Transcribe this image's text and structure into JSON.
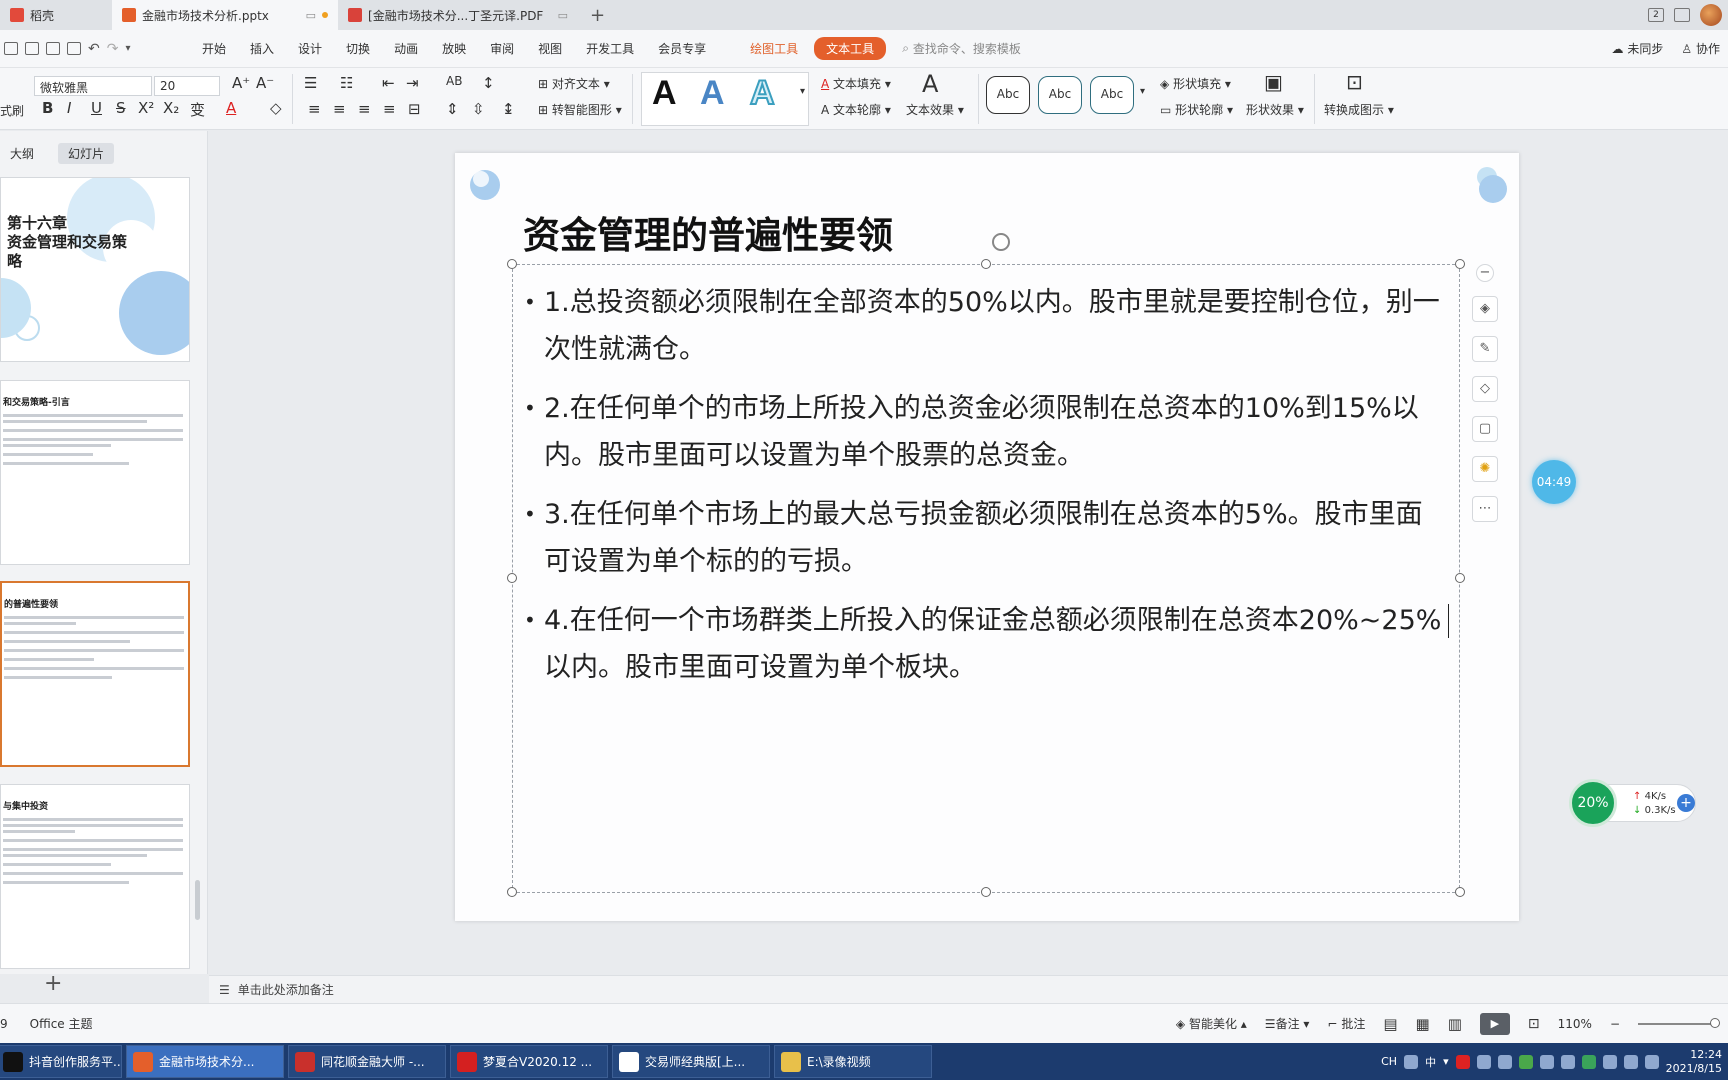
{
  "tabs": [
    {
      "label": "稻壳",
      "color": "#e24a3b"
    },
    {
      "label": "金融市场技术分析.pptx",
      "color": "#e45f2b",
      "active": true
    },
    {
      "label": "[金融市场技术分...丁圣元译.PDF",
      "color": "#d9423a"
    }
  ],
  "window": {
    "badge": "2"
  },
  "menu": {
    "items": [
      "开始",
      "插入",
      "设计",
      "切换",
      "动画",
      "放映",
      "审阅",
      "视图",
      "开发工具",
      "会员专享"
    ],
    "tool1": "绘图工具",
    "tool2": "文本工具",
    "search_placeholder": "查找命令、搜索模板",
    "sync": "未同步",
    "collab": "协作"
  },
  "ribbon": {
    "format_brush": "式刷",
    "font_name": "微软雅黑",
    "font_size": "20",
    "align_text": "对齐文本",
    "smart_shape": "转智能图形",
    "text_fill": "文本填充",
    "text_outline": "文本轮廓",
    "text_effect": "文本效果",
    "shape_fill": "形状填充",
    "shape_outline": "形状轮廓",
    "shape_effect": "形状效果",
    "convert_chart": "转换成图示",
    "abc": "Abc",
    "big_a": "A"
  },
  "leftpanel": {
    "tab_outline": "大纲",
    "tab_slides": "幻灯片",
    "thumb1": {
      "line1": "第十六章",
      "line2": "资金管理和交易策",
      "line3": "略"
    },
    "thumb2": {
      "title": "和交易策略-引言"
    },
    "thumb3": {
      "title": "的普遍性要领"
    },
    "thumb4": {
      "title": "与集中投资"
    }
  },
  "slide": {
    "title": "资金管理的普遍性要领",
    "bullets": [
      "1.总投资额必须限制在全部资本的50%以内。股市里就是要控制仓位，别一次性就满仓。",
      "2.在任何单个的市场上所投入的总资金必须限制在总资本的10%到15%以内。股市里面可以设置为单个股票的总资金。",
      "3.在任何单个市场上的最大总亏损金额必须限制在总资本的5%。股市里面可设置为单个标的的亏损。",
      "4.在任何一个市场群类上所投入的保证金总额必须限制在总资本20%~25%以内。股市里面可设置为单个板块。"
    ]
  },
  "timer": "04:49",
  "net": {
    "percent": "20%",
    "up": "4K/s",
    "down": "0.3K/s"
  },
  "notes": {
    "placeholder": "单击此处添加备注"
  },
  "status": {
    "slide_num": "9",
    "theme": "Office 主题",
    "beautify": "智能美化",
    "notes": "备注",
    "comments": "批注",
    "zoom": "110%"
  },
  "taskbar": {
    "items": [
      {
        "label": "抖音创作服务平...",
        "color": "#111"
      },
      {
        "label": "金融市场技术分...",
        "color": "#e45f2b",
        "active": true
      },
      {
        "label": "同花顺金融大师 -...",
        "color": "#c9302c"
      },
      {
        "label": "梦夏合V2020.12 ...",
        "color": "#d42020"
      },
      {
        "label": "交易师经典版[上...",
        "color": "#ffffff"
      },
      {
        "label": "E:\\录像视频",
        "color": "#e8c04a"
      }
    ],
    "ime1": "CH",
    "ime2": "中",
    "time": "12:24",
    "date": "2021/8/15"
  }
}
